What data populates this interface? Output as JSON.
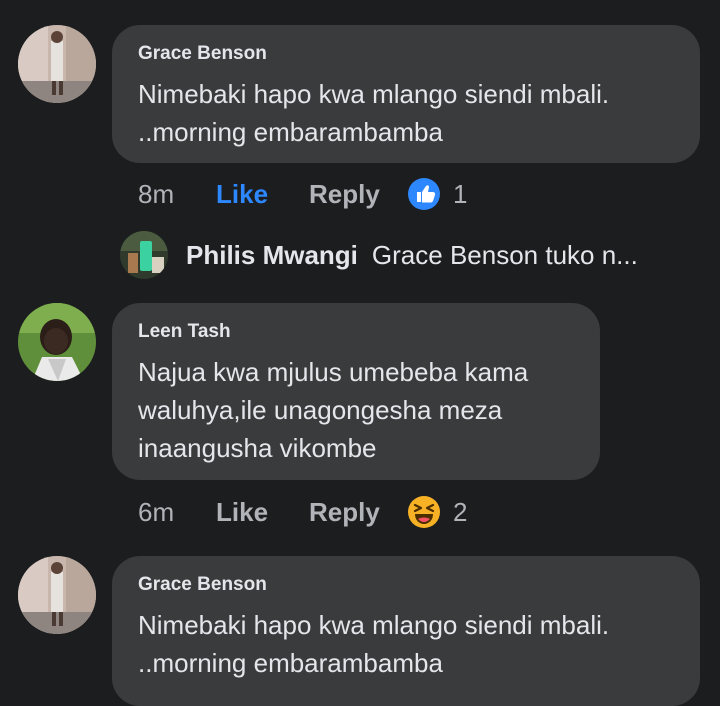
{
  "comments": [
    {
      "author": "Grace Benson",
      "lines": [
        "Nimebaki  hapo kwa mlango siendi mbali.",
        "..morning embarambamba"
      ],
      "time": "8m",
      "like": "Like",
      "reply": "Reply",
      "reaction_icon": "thumbs-up-icon",
      "reaction_count": "1",
      "like_active": true
    },
    {
      "author": "Leen Tash",
      "lines": [
        "Najua kwa mjulus umebeba kama",
        "waluhya,ile unagongesha meza",
        "inaangusha vikombe"
      ],
      "time": "6m",
      "like": "Like",
      "reply": "Reply",
      "reaction_icon": "laughing-face-icon",
      "reaction_count": "2",
      "like_active": false
    },
    {
      "author": "Grace Benson",
      "lines": [
        "Nimebaki  hapo kwa mlango siendi mbali.",
        "..morning embarambamba"
      ]
    }
  ],
  "reply_preview": {
    "author": "Philis Mwangi",
    "text": "Grace Benson tuko n..."
  },
  "colors": {
    "background": "#1c1d1f",
    "bubble": "#3a3b3c",
    "like_active": "#2d88ff",
    "muted": "#b0b3b8",
    "haha": "#f7b125"
  }
}
